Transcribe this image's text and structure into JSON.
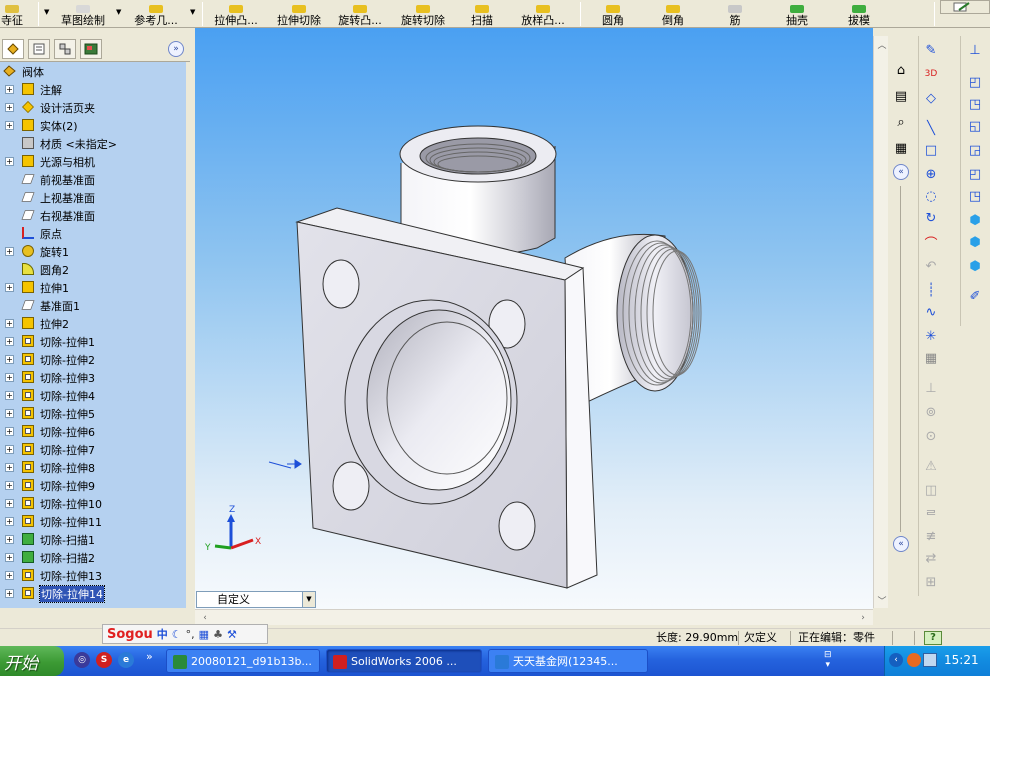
{
  "toolbar": {
    "items": [
      {
        "label": "寺征",
        "has_dropdown": false
      },
      {
        "label": "草图绘制",
        "has_dropdown": true
      },
      {
        "label": "参考几...",
        "has_dropdown": true
      },
      {
        "label": "拉伸凸...",
        "has_dropdown": false
      },
      {
        "label": "拉伸切除",
        "has_dropdown": false
      },
      {
        "label": "旋转凸...",
        "has_dropdown": false
      },
      {
        "label": "旋转切除",
        "has_dropdown": false
      },
      {
        "label": "扫描",
        "has_dropdown": false
      },
      {
        "label": "放样凸...",
        "has_dropdown": false
      },
      {
        "label": "圆角",
        "has_dropdown": false
      },
      {
        "label": "倒角",
        "has_dropdown": false
      },
      {
        "label": "筋",
        "has_dropdown": false
      },
      {
        "label": "抽壳",
        "has_dropdown": false
      },
      {
        "label": "拔模",
        "has_dropdown": false
      }
    ]
  },
  "feature_tree": {
    "root": "阀体",
    "items": [
      {
        "label": "注解",
        "expandable": true,
        "icon": "annotation-icon"
      },
      {
        "label": "设计活页夹",
        "expandable": true,
        "icon": "design-binder-icon"
      },
      {
        "label": "实体(2)",
        "expandable": true,
        "icon": "solid-body-icon"
      },
      {
        "label": "材质 <未指定>",
        "expandable": false,
        "icon": "material-icon"
      },
      {
        "label": "光源与相机",
        "expandable": true,
        "icon": "lights-camera-icon"
      },
      {
        "label": "前视基准面",
        "expandable": false,
        "icon": "plane-icon"
      },
      {
        "label": "上视基准面",
        "expandable": false,
        "icon": "plane-icon"
      },
      {
        "label": "右视基准面",
        "expandable": false,
        "icon": "plane-icon"
      },
      {
        "label": "原点",
        "expandable": false,
        "icon": "origin-icon"
      },
      {
        "label": "旋转1",
        "expandable": true,
        "icon": "revolve-icon"
      },
      {
        "label": "圆角2",
        "expandable": false,
        "icon": "fillet-icon"
      },
      {
        "label": "拉伸1",
        "expandable": true,
        "icon": "extrude-icon"
      },
      {
        "label": "基准面1",
        "expandable": false,
        "icon": "plane-icon"
      },
      {
        "label": "拉伸2",
        "expandable": true,
        "icon": "extrude-icon"
      },
      {
        "label": "切除-拉伸1",
        "expandable": true,
        "icon": "cut-extrude-icon"
      },
      {
        "label": "切除-拉伸2",
        "expandable": true,
        "icon": "cut-extrude-icon"
      },
      {
        "label": "切除-拉伸3",
        "expandable": true,
        "icon": "cut-extrude-icon"
      },
      {
        "label": "切除-拉伸4",
        "expandable": true,
        "icon": "cut-extrude-icon"
      },
      {
        "label": "切除-拉伸5",
        "expandable": true,
        "icon": "cut-extrude-icon"
      },
      {
        "label": "切除-拉伸6",
        "expandable": true,
        "icon": "cut-extrude-icon"
      },
      {
        "label": "切除-拉伸7",
        "expandable": true,
        "icon": "cut-extrude-icon"
      },
      {
        "label": "切除-拉伸8",
        "expandable": true,
        "icon": "cut-extrude-icon"
      },
      {
        "label": "切除-拉伸9",
        "expandable": true,
        "icon": "cut-extrude-icon"
      },
      {
        "label": "切除-拉伸10",
        "expandable": true,
        "icon": "cut-extrude-icon"
      },
      {
        "label": "切除-拉伸11",
        "expandable": true,
        "icon": "cut-extrude-icon"
      },
      {
        "label": "切除-扫描1",
        "expandable": true,
        "icon": "cut-sweep-icon"
      },
      {
        "label": "切除-扫描2",
        "expandable": true,
        "icon": "cut-sweep-icon"
      },
      {
        "label": "切除-拉伸13",
        "expandable": true,
        "icon": "cut-extrude-icon"
      },
      {
        "label": "切除-拉伸14",
        "expandable": true,
        "icon": "cut-extrude-icon",
        "selected": true
      }
    ]
  },
  "viewport": {
    "configuration": "自定义",
    "triad": {
      "x": "X",
      "y": "Y",
      "z": "Z"
    }
  },
  "statusbar": {
    "length": "长度: 29.90mm",
    "definition": "欠定义",
    "editing": "正在编辑：零件",
    "help": "?"
  },
  "ime": {
    "logo": "Sogou",
    "mode": "中"
  },
  "taskbar": {
    "start": "开始",
    "tasks": [
      {
        "label": "20080121_d91b13b...",
        "icon": "image-viewer-icon",
        "active": false
      },
      {
        "label": "SolidWorks 2006 ...",
        "icon": "solidworks-icon",
        "active": true
      },
      {
        "label": "天天基金网(12345...",
        "icon": "browser-icon",
        "active": false
      }
    ],
    "clock": "15:21"
  },
  "colors": {
    "viewport_top": "#4aa0f2",
    "tree_bg": "#b5d1f0",
    "selection": "#2f54b5",
    "taskbar": "#2563de",
    "start": "#3c9a34"
  }
}
